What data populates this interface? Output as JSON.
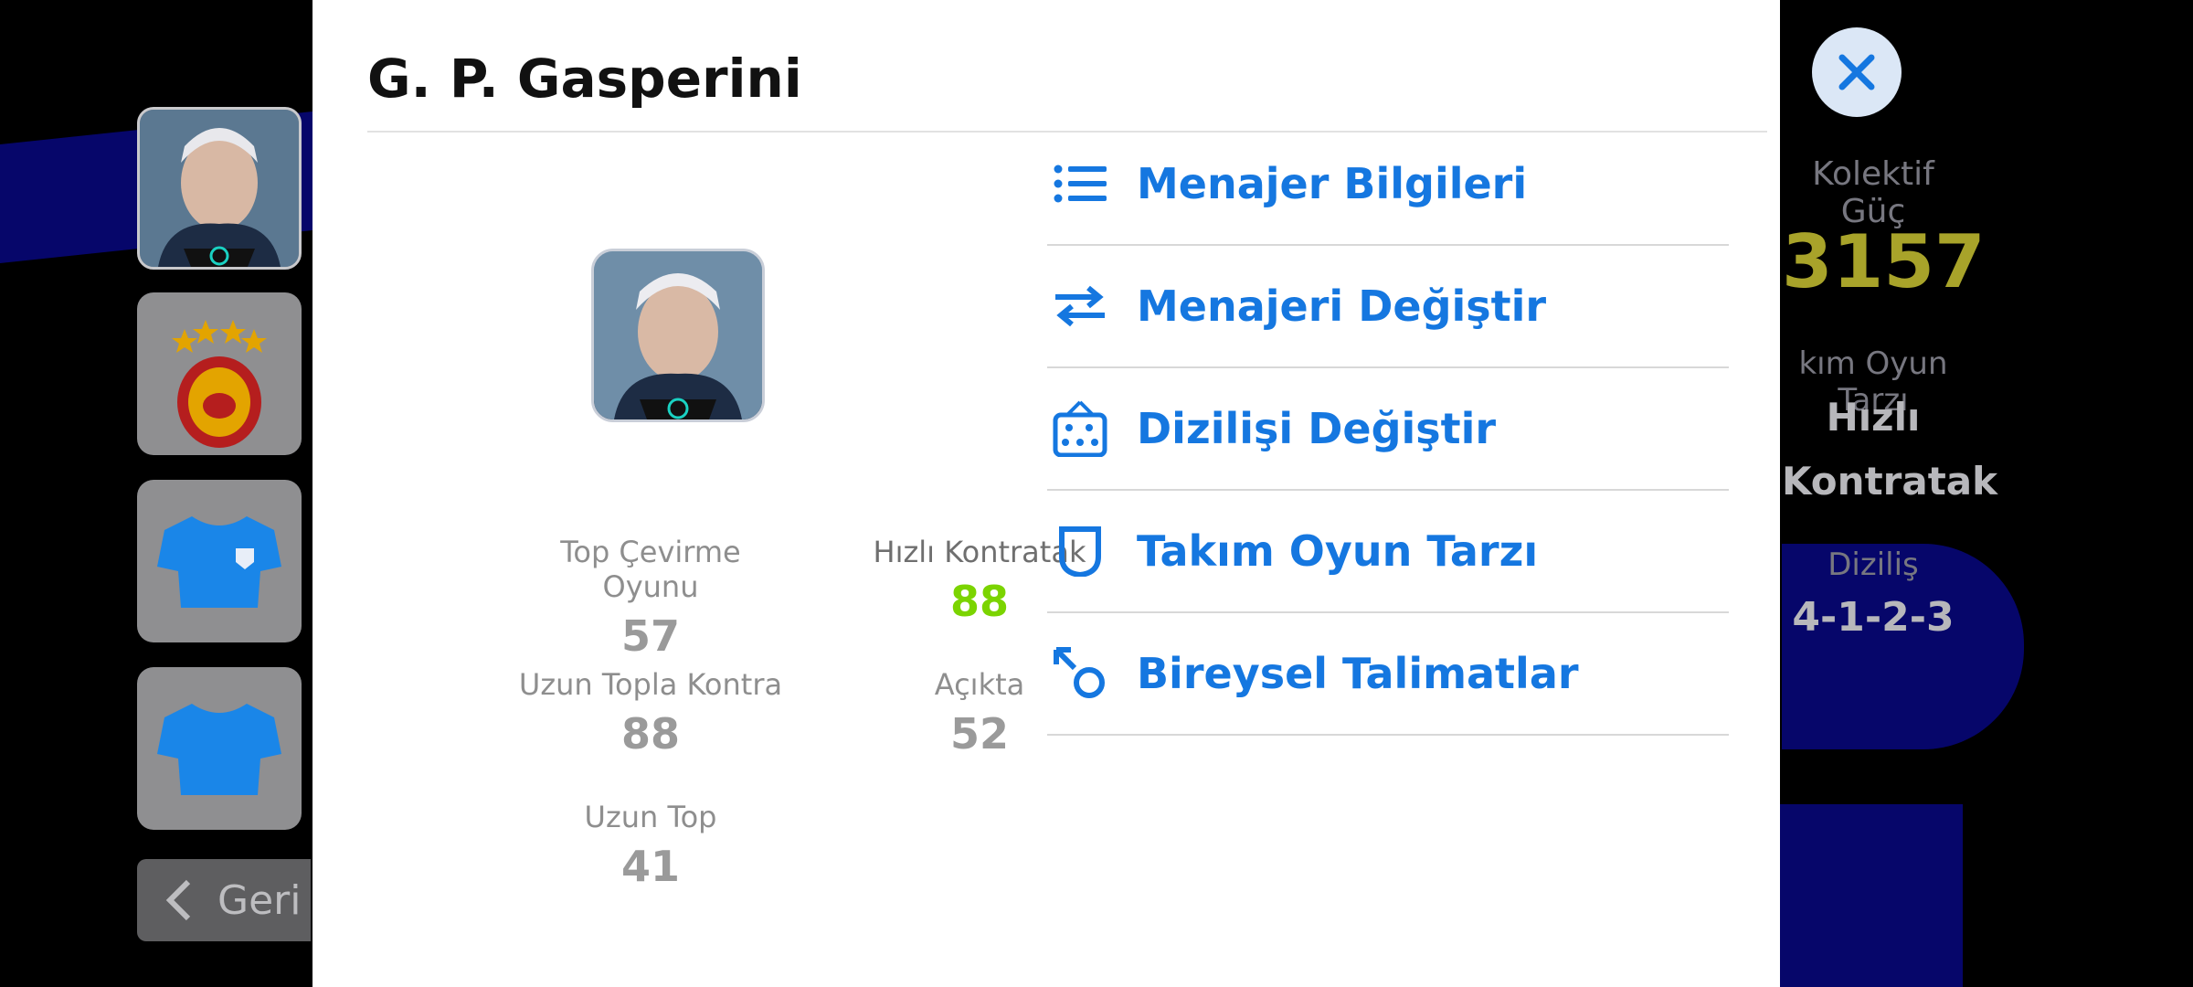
{
  "background": {
    "back_label": "Geri",
    "right_panel": {
      "collective_power_label": "Kolektif Güç",
      "collective_power_value": "3157",
      "team_style_label": "kım Oyun Tarzı",
      "team_style_value_line1": "Hızlı",
      "team_style_value_line2": "Kontratak",
      "formation_label": "Diziliş",
      "formation_value": "4-1-2-3"
    }
  },
  "modal": {
    "title": "G. P. Gasperini",
    "stats": [
      {
        "label": "Top Çevirme Oyunu",
        "value": "57",
        "highlight": false
      },
      {
        "label": "Hızlı Kontratak",
        "value": "88",
        "highlight": true
      },
      {
        "label": "Uzun Topla Kontra",
        "value": "88",
        "highlight": false
      },
      {
        "label": "Açıkta",
        "value": "52",
        "highlight": false
      },
      {
        "label": "Uzun Top",
        "value": "41",
        "highlight": false
      }
    ],
    "menu": [
      {
        "label": "Menajer Bilgileri",
        "icon": "list-icon"
      },
      {
        "label": "Menajeri Değiştir",
        "icon": "swap-arrows-icon"
      },
      {
        "label": "Dizilişi Değiştir",
        "icon": "formation-board-icon"
      },
      {
        "label": "Takım Oyun Tarzı",
        "icon": "shield-icon"
      },
      {
        "label": "Bireysel Talimatlar",
        "icon": "instruction-arrow-icon"
      }
    ]
  },
  "colors": {
    "accent": "#1577e0",
    "highlight_value": "#7bd400",
    "power_value": "#a8a32a"
  }
}
